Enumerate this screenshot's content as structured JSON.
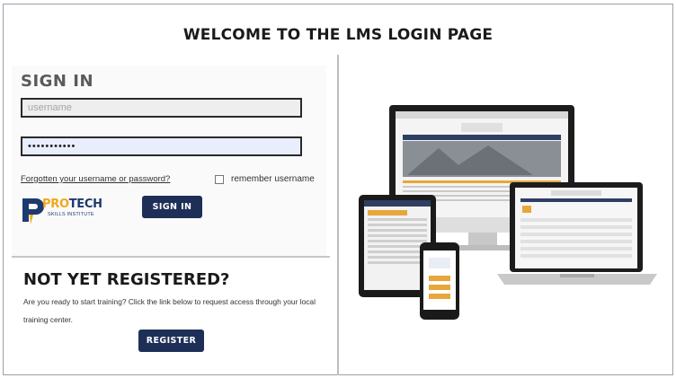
{
  "page": {
    "title": "WELCOME TO THE LMS LOGIN PAGE"
  },
  "login": {
    "heading": "SIGN IN",
    "username_placeholder": "username",
    "password_value": "•••••••••••",
    "forgot_link": "Forgotten your username or password?",
    "remember_label": "remember username",
    "signin_button": "SIGN IN"
  },
  "logo": {
    "pro": "PRO",
    "tech": "TECH",
    "sub": "SKILLS INSTITUTE"
  },
  "register": {
    "heading": "NOT YET REGISTERED?",
    "text": "Are you ready to start training? Click the link below to request access through your local training center.",
    "button": "REGISTER"
  },
  "colors": {
    "button": "#1e2f57",
    "logo_orange": "#f0a81a",
    "logo_navy": "#1d3a6e"
  }
}
